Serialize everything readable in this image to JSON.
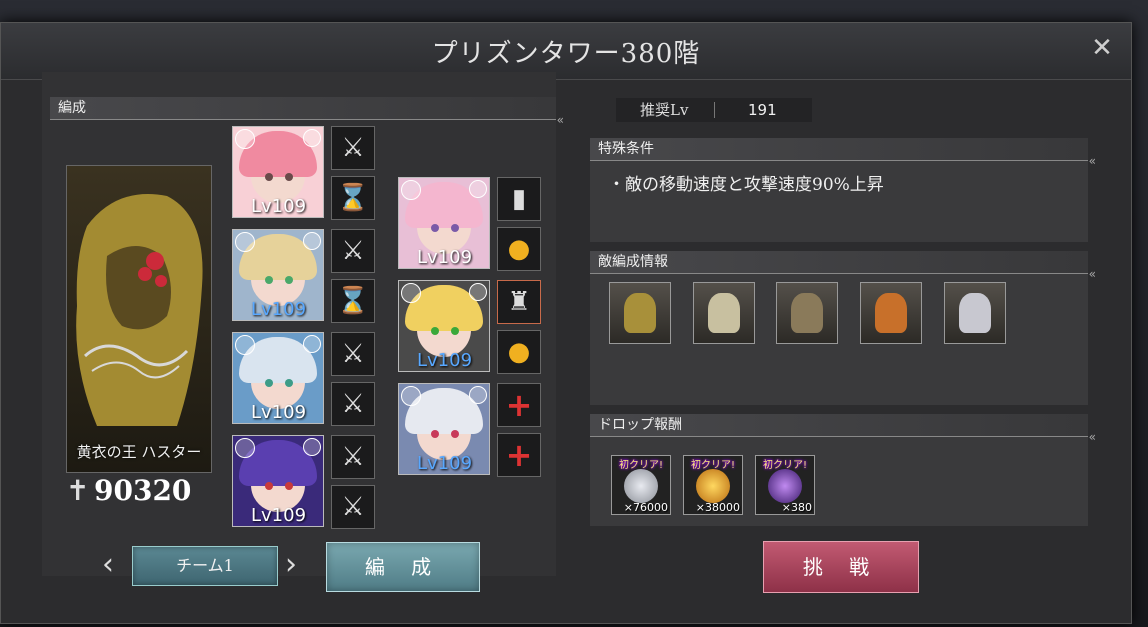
{
  "title": "プリズンタワー380階",
  "close_symbol": "✕",
  "formation": {
    "header": "編成",
    "leader": {
      "name": "黄衣の王 ハスター",
      "colors": [
        "#b49a3a",
        "#cc2a3a"
      ]
    },
    "power_icon": "✝",
    "power": "90320",
    "characters": [
      {
        "level": "Lv109",
        "level_color": "pink-white",
        "hair": "#f08aa0",
        "bg": "#f8d0d6",
        "eye": "#6a4a4a"
      },
      {
        "level": "Lv109",
        "level_color": "blue",
        "hair": "#e6d29a",
        "bg": "#9fb5cc",
        "eye": "#4aa86a"
      },
      {
        "level": "Lv109",
        "level_color": "white",
        "hair": "#d9e4ef",
        "bg": "#6a9cc8",
        "eye": "#3c9c88"
      },
      {
        "level": "Lv109",
        "level_color": "white",
        "hair": "#5a3fb0",
        "bg": "#3a2a7a",
        "eye": "#c83a3a"
      },
      {
        "level": "Lv109",
        "level_color": "white",
        "hair": "#f4b6cf",
        "bg": "#e8bfd6",
        "eye": "#7a5aa8"
      },
      {
        "level": "Lv109",
        "level_color": "blue",
        "hair": "#f0d060",
        "bg": "#4a4a4a",
        "eye": "#3aa83a"
      },
      {
        "level": "Lv109",
        "level_color": "blue",
        "hair": "#e6e9f0",
        "bg": "#7a8ab0",
        "eye": "#c83a5a"
      }
    ],
    "equip_icons": [
      "sword-icon",
      "hourglass-icon",
      "sword-icon",
      "hourglass-icon",
      "sword-icon",
      "sword-icon",
      "sword-icon",
      "sword-icon",
      "whistle-icon",
      "potion-icon",
      "armor-icon",
      "potion-icon",
      "add-icon",
      "add-icon"
    ],
    "team": {
      "prev": "‹",
      "label": "チーム1",
      "next": "›"
    },
    "form_button": "編 成"
  },
  "recommended": {
    "label": "推奨Lv",
    "value": "191"
  },
  "special": {
    "header": "特殊条件",
    "text": "・敵の移動速度と攻撃速度90%上昇"
  },
  "enemies": {
    "header": "敵編成情報",
    "items": [
      {
        "name": "gold-statue-enemy",
        "color": "#a8903a"
      },
      {
        "name": "halo-angel-enemy",
        "color": "#c8c0a0"
      },
      {
        "name": "winged-tower-enemy",
        "color": "#8a7a5a"
      },
      {
        "name": "orange-golem-enemy",
        "color": "#c8702a"
      },
      {
        "name": "white-armor-enemy",
        "color": "#c8c8d0"
      }
    ]
  },
  "drops": {
    "header": "ドロップ報酬",
    "items": [
      {
        "badge": "初クリア!",
        "qty": "×76000",
        "color": "#b8bcc4"
      },
      {
        "badge": "初クリア!",
        "qty": "×38000",
        "color": "#e0a020"
      },
      {
        "badge": "初クリア!",
        "qty": "×380",
        "color": "#6a3aa0"
      }
    ]
  },
  "challenge_button": "挑 戦",
  "colors": {
    "accent_pink": "#c25a72",
    "teal": "#5b8893",
    "level_blue": "#58a8ff"
  }
}
